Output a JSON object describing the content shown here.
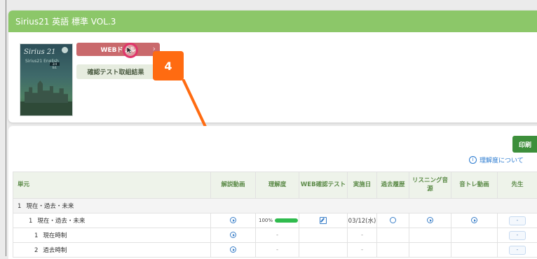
{
  "card": {
    "title": "Sirius21 英語 標準 VOL.3",
    "book_cover": {
      "title": "Sirius 21",
      "subtitle": "Sirius21 English",
      "badge": "3rd Ed."
    },
    "web_drill_label": "WEBドリル",
    "chevron": "›",
    "test_results_label": "確認テスト取組結果"
  },
  "annotation": {
    "step_number": "4",
    "accent_color": "#ff6b11"
  },
  "toolbar": {
    "print_label": "印刷",
    "info_icon": "i",
    "about_label": "理解度について"
  },
  "table": {
    "headers": [
      "単元",
      "解説動画",
      "理解度",
      "WEB確認テスト",
      "実施日",
      "過去履歴",
      "リスニング音源",
      "音トレ動画",
      "先生"
    ],
    "rows": [
      {
        "kind": "chapter",
        "num": "1",
        "label": "現在・過去・未来"
      },
      {
        "kind": "section",
        "num": "1",
        "label": "現在・過去・未来",
        "progress_label": "100%",
        "progress_value": 1.0,
        "date": "03/12(水)",
        "teacher": "-"
      },
      {
        "kind": "item",
        "num": "1",
        "label": "現在時制",
        "progress": "-",
        "date": "-",
        "teacher": "-"
      },
      {
        "kind": "item",
        "num": "2",
        "label": "過去時制",
        "progress": "-",
        "date": "-",
        "teacher": "-"
      }
    ]
  },
  "colors": {
    "header_green": "#8cc769",
    "web_drill_red": "#c9696c",
    "print_green": "#3d8f3b",
    "link_blue": "#2b7bd0",
    "progress_green": "#2fbb4d"
  }
}
